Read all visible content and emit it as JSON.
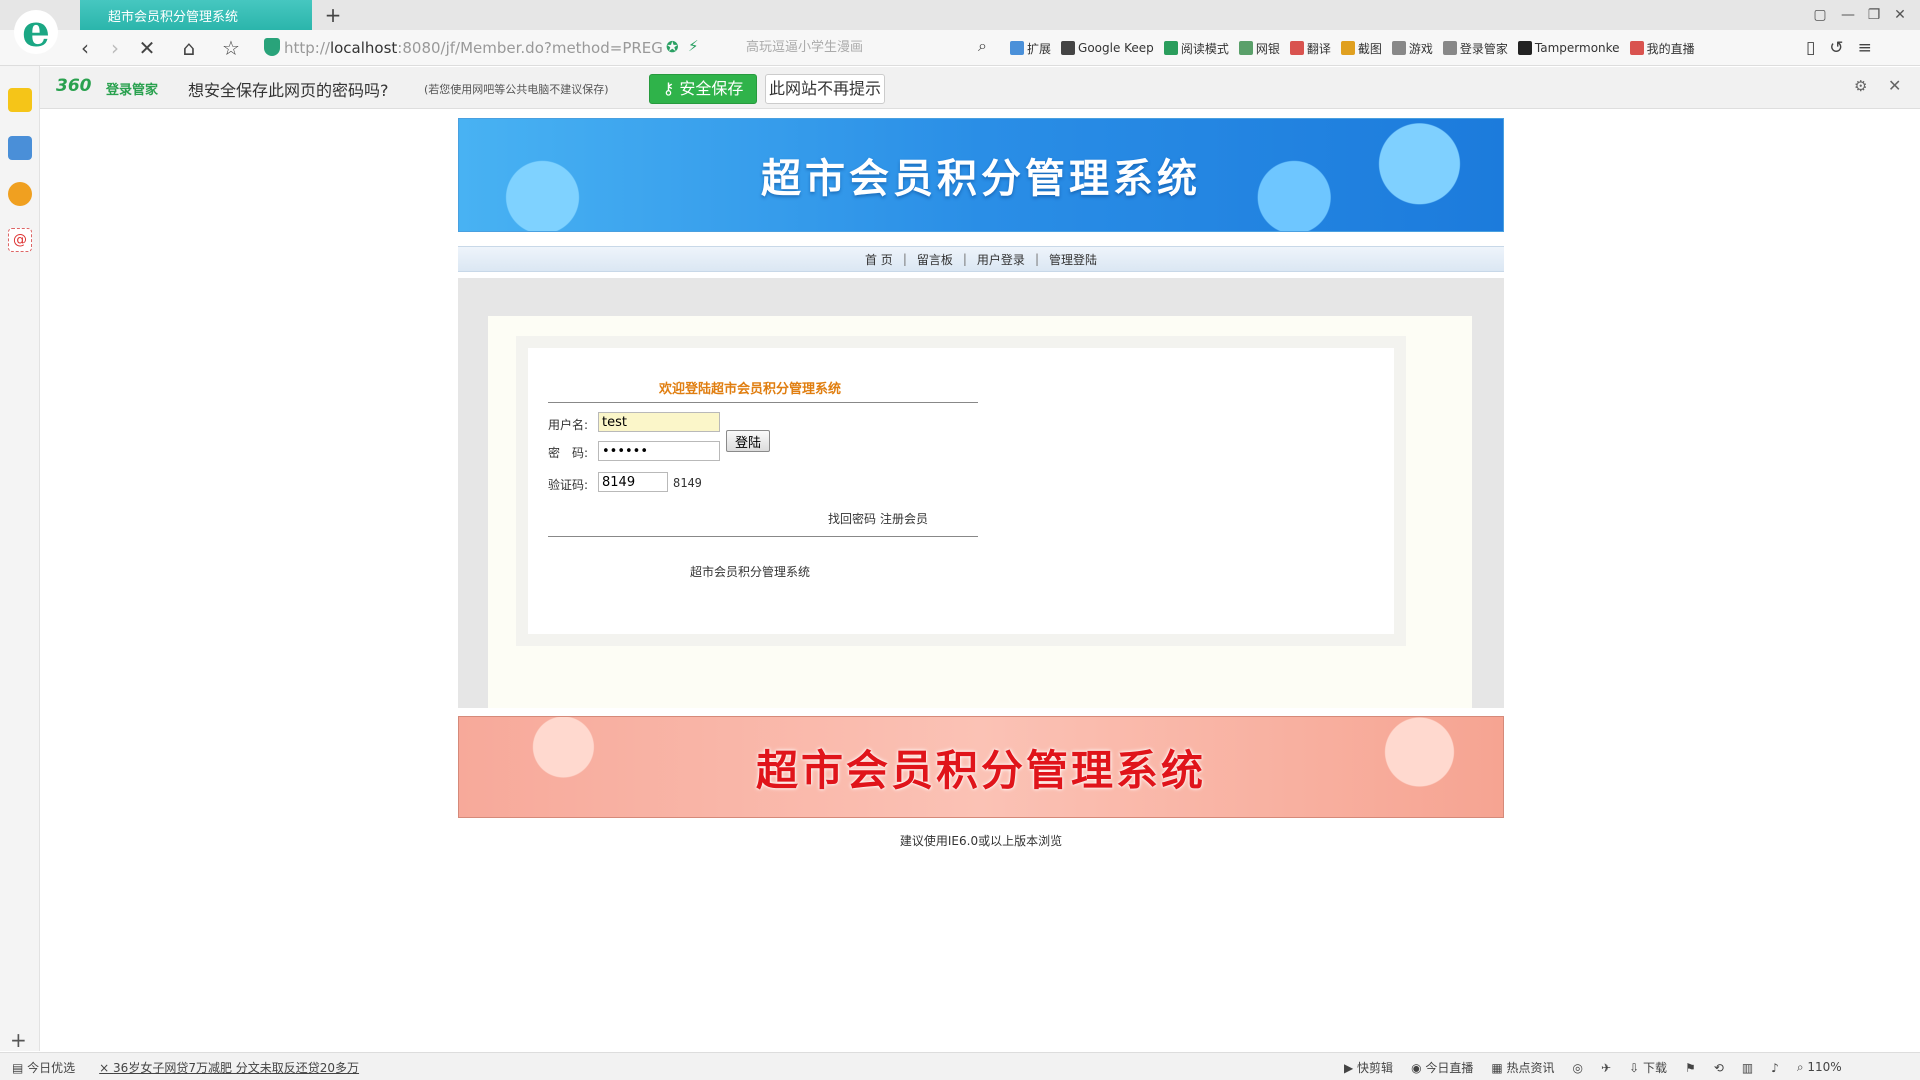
{
  "browser": {
    "tab_title": "超市会员积分管理系统",
    "new_tab": "+",
    "address_prefix": "http://",
    "address_host": "localhost",
    "address_rest": ":8080/jf/Member.do?method=PREG",
    "search_placeholder": "高玩逗逼小学生漫画",
    "bookmarks": [
      "扩展",
      "Google Keep",
      "阅读模式",
      "网银",
      "翻译",
      "截图",
      "游戏",
      "登录管家",
      "Tampermonke",
      "我的直播"
    ],
    "bookmark_colors": [
      "#4a90d9",
      "#444444",
      "#2a9d5c",
      "#5aa06a",
      "#d9534f",
      "#e0a020",
      "#888888",
      "#888888",
      "#222222",
      "#d9534f"
    ]
  },
  "password_bar": {
    "brand": "360",
    "brand_sub": "登录管家",
    "question": "想安全保存此网页的密码吗?",
    "hint": "(若您使用网吧等公共电脑不建议保存)",
    "save_label": "安全保存",
    "never_label": "此网站不再提示"
  },
  "site": {
    "header_title": "超市会员积分管理系统",
    "nav": [
      "首  页",
      "留言板",
      "用户登录",
      "管理登陆"
    ],
    "nav_sep": "|",
    "login": {
      "welcome": "欢迎登陆超市会员积分管理系统",
      "username_label": "用户名:",
      "username_value": "test",
      "password_label": "密　码:",
      "password_value": "••••••",
      "captcha_label": "验证码:",
      "captcha_value": "8149",
      "captcha_text": "8149",
      "login_button": "登陆",
      "forgot_link": "找回密码",
      "register_link": "注册会员",
      "footer_text": "超市会员积分管理系统"
    },
    "footer_title": "超市会员积分管理系统",
    "footer_note": "建议使用IE6.0或以上版本浏览"
  },
  "statusbar": {
    "left": [
      "今日优选",
      "36岁女子网贷7万减肥 分文未取反还贷20多万"
    ],
    "right": [
      "快剪辑",
      "今日直播",
      "热点资讯",
      "下载",
      "110%"
    ]
  },
  "colors": {
    "brand_green": "#2fb34a",
    "tab_teal": "#2bb5ab",
    "header_blue": "#2a8ee6",
    "welcome_orange": "#e07e10",
    "footer_red": "#e0141a"
  }
}
